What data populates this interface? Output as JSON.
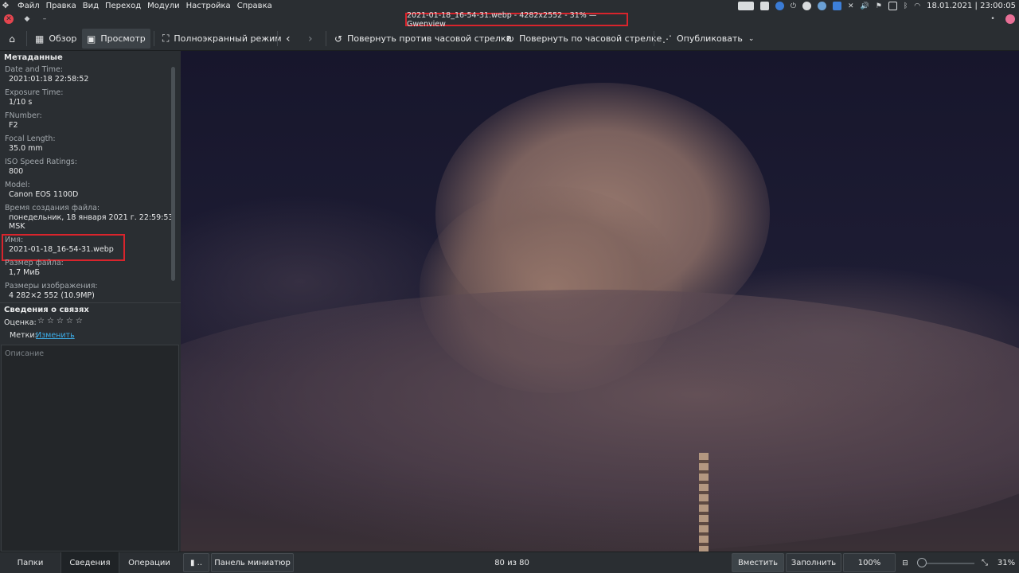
{
  "top_panel": {
    "menu": [
      "Файл",
      "Правка",
      "Вид",
      "Переход",
      "Модули",
      "Настройка",
      "Справка"
    ],
    "clock": "18.01.2021 | 23:00:05"
  },
  "window": {
    "title": "2021-01-18_16-54-31.webp - 4282x2552 - 31% — Gwenview"
  },
  "toolbar": {
    "browse": "Обзор",
    "view": "Просмотр",
    "fullscreen": "Полноэкранный режим",
    "rotate_left": "Повернуть против часовой стрелки",
    "rotate_right": "Повернуть по часовой стрелке",
    "share": "Опубликовать"
  },
  "sidebar": {
    "metadata_title": "Метаданные",
    "metadata": [
      {
        "label": "Date and Time:",
        "value": "2021:01:18 22:58:52"
      },
      {
        "label": "Exposure Time:",
        "value": "1/10 s"
      },
      {
        "label": "FNumber:",
        "value": "F2"
      },
      {
        "label": "Focal Length:",
        "value": "35.0 mm"
      },
      {
        "label": "ISO Speed Ratings:",
        "value": "800"
      },
      {
        "label": "Model:",
        "value": "Canon EOS 1100D"
      },
      {
        "label": "Время создания файла:",
        "value": "понедельник, 18 января 2021 г. 22:59:53",
        "value2": "MSK"
      },
      {
        "label": "Имя:",
        "value": "2021-01-18_16-54-31.webp"
      },
      {
        "label": "Размер файла:",
        "value": "1,7 МиБ"
      },
      {
        "label": "Размеры изображения:",
        "value": "4 282×2 552 (10.9MP)"
      }
    ],
    "relations_title": "Сведения о связях",
    "rating_label": "Оценка:",
    "rating": 0,
    "tags_label": "Метки:",
    "tags_link": "Изменить",
    "description_placeholder": "Описание"
  },
  "status_bar": {
    "tabs": [
      "Папки",
      "Сведения",
      "Операции"
    ],
    "thumbnail_bar": "Панель миниатюр",
    "counter": "80 из 80",
    "fit": "Вместить",
    "fill": "Заполнить",
    "actual": "100%",
    "zoom": "31%"
  },
  "colors": {
    "highlight": "#d9242c",
    "link": "#3daee9"
  }
}
